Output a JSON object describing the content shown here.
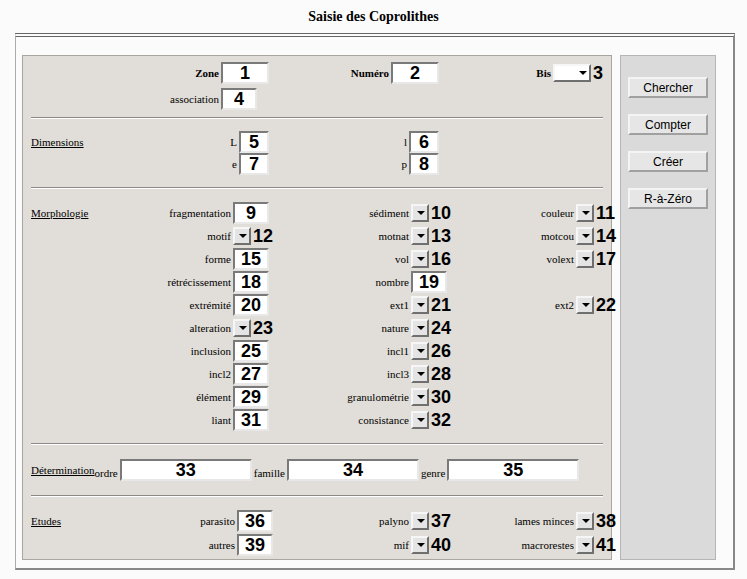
{
  "window": {
    "title": "Saisie des Coprolithes"
  },
  "sections": [
    {
      "kind": "header",
      "title": "",
      "rows": [
        [
          {
            "label": "Zone",
            "kind": "code-input",
            "marker": "1"
          },
          {
            "label": "Numéro",
            "kind": "code-input",
            "marker": "2"
          },
          {
            "label": "Bis",
            "kind": "wide-select",
            "marker": "3"
          }
        ],
        [
          {
            "label": "association",
            "kind": "input",
            "marker": "4"
          }
        ]
      ]
    },
    {
      "kind": "dimensions",
      "title": "Dimensions",
      "rows": [
        [
          {
            "label": "L",
            "kind": "small-input",
            "marker": "5"
          },
          {
            "label": "l",
            "kind": "small-input",
            "marker": "6"
          }
        ],
        [
          {
            "label": "e",
            "kind": "small-input",
            "marker": "7"
          },
          {
            "label": "p",
            "kind": "small-input",
            "marker": "8"
          }
        ]
      ]
    },
    {
      "kind": "morphology",
      "title": "Morphologie",
      "rows": [
        [
          {
            "label": "fragmentation",
            "kind": "input",
            "marker": "9"
          },
          {
            "label": "sédiment",
            "kind": "select",
            "marker": "10"
          },
          {
            "label": "couleur",
            "kind": "select",
            "marker": "11"
          }
        ],
        [
          {
            "label": "motif",
            "kind": "select",
            "marker": "12"
          },
          {
            "label": "motnat",
            "kind": "select",
            "marker": "13"
          },
          {
            "label": "motcou",
            "kind": "select",
            "marker": "14"
          }
        ],
        [
          {
            "label": "forme",
            "kind": "input",
            "marker": "15"
          },
          {
            "label": "vol",
            "kind": "select",
            "marker": "16"
          },
          {
            "label": "volext",
            "kind": "select",
            "marker": "17"
          }
        ],
        [
          {
            "label": "rétrécissement",
            "kind": "input",
            "marker": "18"
          },
          {
            "label": "nombre",
            "kind": "input",
            "marker": "19"
          }
        ],
        [
          {
            "label": "extrémité",
            "kind": "input",
            "marker": "20"
          },
          {
            "label": "ext1",
            "kind": "select",
            "marker": "21"
          },
          {
            "label": "ext2",
            "kind": "select",
            "marker": "22"
          }
        ],
        [
          {
            "label": "alteration",
            "kind": "select",
            "marker": "23"
          },
          {
            "label": "nature",
            "kind": "select",
            "marker": "24"
          }
        ],
        [
          {
            "label": "inclusion",
            "kind": "input",
            "marker": "25"
          },
          {
            "label": "incl1",
            "kind": "select",
            "marker": "26"
          }
        ],
        [
          {
            "label": "incl2",
            "kind": "input",
            "marker": "27"
          },
          {
            "label": "incl3",
            "kind": "select",
            "marker": "28"
          }
        ],
        [
          {
            "label": "élément",
            "kind": "input",
            "marker": "29"
          },
          {
            "label": "granulométrie",
            "kind": "select",
            "marker": "30"
          }
        ],
        [
          {
            "label": "liant",
            "kind": "input",
            "marker": "31"
          },
          {
            "label": "consistance",
            "kind": "select",
            "marker": "32"
          }
        ]
      ]
    },
    {
      "kind": "determination",
      "title": "Détermination",
      "fields": [
        {
          "label": "ordre",
          "marker": "33"
        },
        {
          "label": "famille",
          "marker": "34"
        },
        {
          "label": "genre",
          "marker": "35"
        }
      ]
    },
    {
      "kind": "studies",
      "title": "Etudes",
      "rows": [
        [
          {
            "label": "parasito",
            "kind": "input",
            "marker": "36"
          },
          {
            "label": "palyno",
            "kind": "select",
            "marker": "37"
          },
          {
            "label": "lames minces",
            "kind": "select",
            "marker": "38"
          }
        ],
        [
          {
            "label": "autres",
            "kind": "input",
            "marker": "39"
          },
          {
            "label": "mif",
            "kind": "select",
            "marker": "40"
          },
          {
            "label": "macrorestes",
            "kind": "select",
            "marker": "41"
          }
        ]
      ]
    }
  ],
  "buttons": [
    "Chercher",
    "Compter",
    "Créer",
    "R-à-Zéro"
  ]
}
